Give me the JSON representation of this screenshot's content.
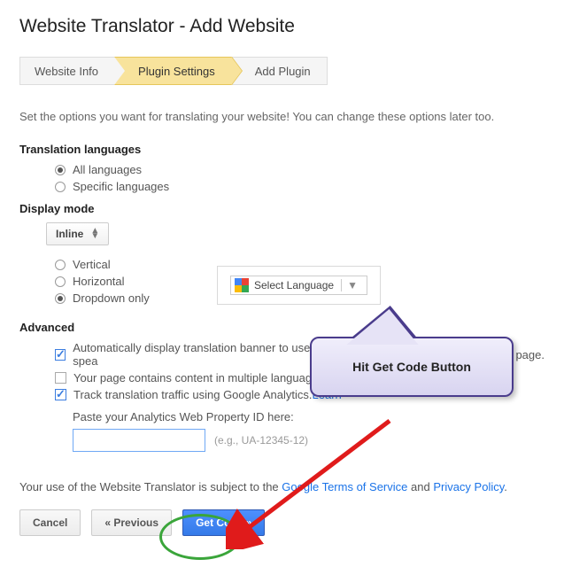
{
  "title": "Website Translator - Add Website",
  "steps": {
    "s1": "Website Info",
    "s2": "Plugin Settings",
    "s3": "Add Plugin"
  },
  "intro": "Set the options you want for translating your website! You can change these options later too.",
  "sections": {
    "translation_languages": "Translation languages",
    "display_mode": "Display mode",
    "advanced": "Advanced"
  },
  "translation_options": {
    "all": "All languages",
    "specific": "Specific languages"
  },
  "display": {
    "selector_label": "Inline",
    "vertical": "Vertical",
    "horizontal": "Horizontal",
    "dropdown": "Dropdown only",
    "widget_label": "Select Language"
  },
  "advanced": {
    "opt1": "Automatically display translation banner to users spea",
    "opt1_tail": "page.",
    "opt2": "Your page contains content in multiple languages.",
    "opt3_a": "Track translation traffic using Google Analytics. ",
    "opt3_link": "Learn",
    "paste_label": "Paste your Analytics Web Property ID here:",
    "id_value": "",
    "id_hint": "(e.g., UA-12345-12)"
  },
  "footer": {
    "prefix": "Your use of the Website Translator is subject to the ",
    "tos": "Google Terms of Service",
    "and": " and ",
    "pp": "Privacy Policy",
    "suffix": "."
  },
  "buttons": {
    "cancel": "Cancel",
    "previous": "« Previous",
    "get_code": "Get Code »"
  },
  "annotation": {
    "callout": "Hit Get Code Button"
  }
}
